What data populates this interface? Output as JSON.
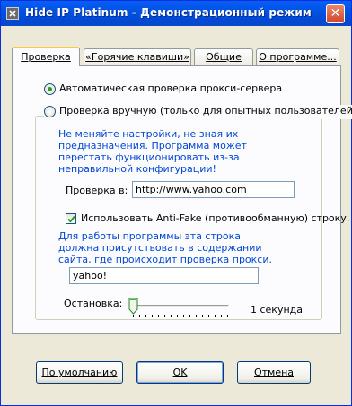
{
  "window": {
    "title": "Hide IP Platinum - Демонстрационный режим",
    "close_glyph": "✕"
  },
  "tabs": [
    {
      "label": "Проверка",
      "active": true
    },
    {
      "label": "«Горячие клавиши»",
      "active": false
    },
    {
      "label": "Общие",
      "active": false
    },
    {
      "label": "О программе...",
      "active": false
    }
  ],
  "radios": {
    "auto": {
      "label": "Автоматическая проверка прокси-сервера",
      "checked": true
    },
    "manual": {
      "label": "Проверка вручную (только для опытных пользователей)",
      "checked": false
    }
  },
  "manual": {
    "warning": "Не меняйте настройки, не зная их предназначения. Программа может перестать функционировать из-за неправильной конфигурации!",
    "check_url_label": "Проверка в:",
    "check_url_value": "http://www.yahoo.com",
    "antifake_label": "Использовать Anti-Fake (противообманную) строку.",
    "antifake_checked": true,
    "antifake_hint": "Для работы программы эта строка должна присутствовать в содержании сайта, где происходит проверка прокси.",
    "antifake_value": "yahoo!",
    "stop_label": "Остановка:",
    "stop_value_text": "1 секунда",
    "stop_slider_position": 0
  },
  "buttons": {
    "defaults": "По умолчанию",
    "ok": "OK",
    "cancel": "Отмена"
  },
  "colors": {
    "titlebar": "#0053e3",
    "hint_text": "#0046d5",
    "tab_highlight": "#ffc73c"
  }
}
